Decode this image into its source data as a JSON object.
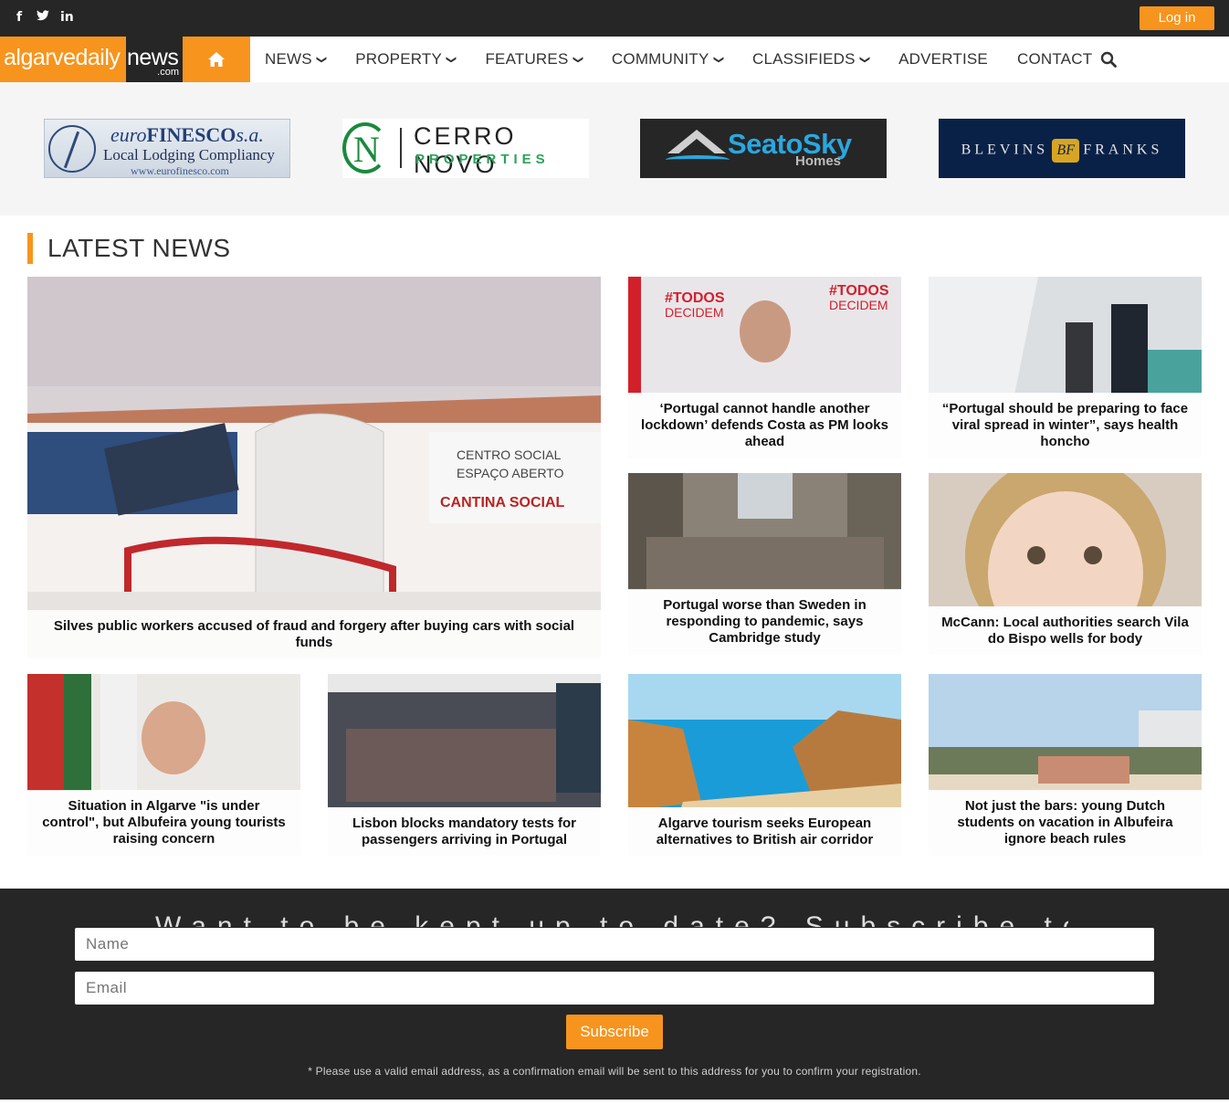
{
  "topbar": {
    "social": [
      {
        "icon": "facebook-icon",
        "glyph": "f"
      },
      {
        "icon": "twitter-icon",
        "glyph": "🐦"
      },
      {
        "icon": "linkedin-icon",
        "glyph": "in"
      }
    ],
    "login_label": "Log in"
  },
  "brand": {
    "part1": "algarvedaily",
    "part2": "news",
    "part3": ".com"
  },
  "nav": {
    "items": [
      {
        "label": "NEWS",
        "dropdown": true
      },
      {
        "label": "PROPERTY",
        "dropdown": true
      },
      {
        "label": "FEATURES",
        "dropdown": true
      },
      {
        "label": "COMMUNITY",
        "dropdown": true
      },
      {
        "label": "CLASSIFIEDS",
        "dropdown": true
      },
      {
        "label": "ADVERTISE",
        "dropdown": false
      },
      {
        "label": "CONTACT",
        "dropdown": false
      }
    ]
  },
  "sponsors": {
    "finesco": {
      "l1a": "euro",
      "l1b": "FINESCO",
      "l1c": "s.a.",
      "l2": "Local Lodging Compliancy",
      "l3": "www.eurofinesco.com"
    },
    "cerro": {
      "l1": "CERRO NOVO",
      "l2": "PROPERTIES"
    },
    "seatosky": {
      "l1": "SeatoSky",
      "l2": "Homes"
    },
    "blevins": {
      "a": "BLEVINS",
      "mono": "BF",
      "b": "FRANKS"
    }
  },
  "section": {
    "title": "LATEST NEWS"
  },
  "articles": [
    {
      "title": "Silves public workers accused of fraud and forgery after buying cars with social funds"
    },
    {
      "title": "‘Portugal cannot handle another lockdown’ defends Costa as PM looks ahead"
    },
    {
      "title": "“Portugal should be preparing to face viral spread in winter”, says health honcho"
    },
    {
      "title": "Portugal worse than Sweden in responding to pandemic, says Cambridge study"
    },
    {
      "title": "McCann: Local authorities search Vila do Bispo wells for body"
    },
    {
      "title": "Situation in Algarve \"is under control\", but Albufeira young tourists raising concern"
    },
    {
      "title": "Lisbon blocks mandatory tests for passengers arriving in Portugal"
    },
    {
      "title": "Algarve tourism seeks European alternatives to British air corridor"
    },
    {
      "title": "Not just the bars: young Dutch students on vacation in Albufeira ignore beach rules"
    }
  ],
  "newsletter": {
    "heading": "Want to be kept up to date? Subscribe to our email newsletter",
    "name_placeholder": "Name",
    "email_placeholder": "Email",
    "subscribe_label": "Subscribe",
    "note": "* Please use a valid email address, as a confirmation email will be sent to this address for you to confirm your registration."
  },
  "colors": {
    "accent": "#f7941d",
    "dark": "#262626"
  }
}
